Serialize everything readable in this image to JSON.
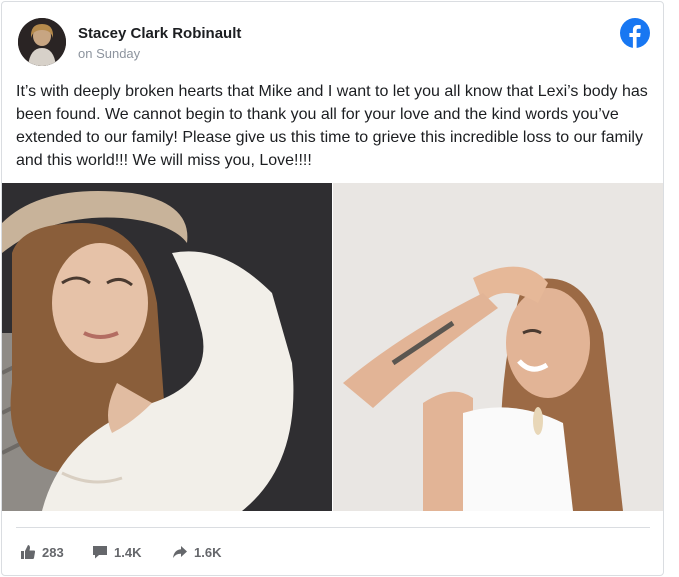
{
  "post": {
    "author": "Stacey Clark Robinault",
    "timestamp": "on Sunday",
    "text": "It’s with deeply broken hearts that Mike and I want to let you all know that Lexi’s body has been found. We cannot begin to thank you all for your love and the kind words you’ve extended to our family! Please give us this time to grieve this incredible loss to our family and this world!!! We will miss you, Love!!!!"
  },
  "stats": {
    "likes": "283",
    "comments": "1.4K",
    "shares": "1.6K"
  },
  "icons": {
    "brand": "facebook-logo-icon",
    "like": "thumbs-up-icon",
    "comment": "comment-bubble-icon",
    "share": "share-arrow-icon"
  },
  "colors": {
    "brand_blue": "#1877f2",
    "text": "#1c1e21",
    "muted": "#65676b"
  }
}
